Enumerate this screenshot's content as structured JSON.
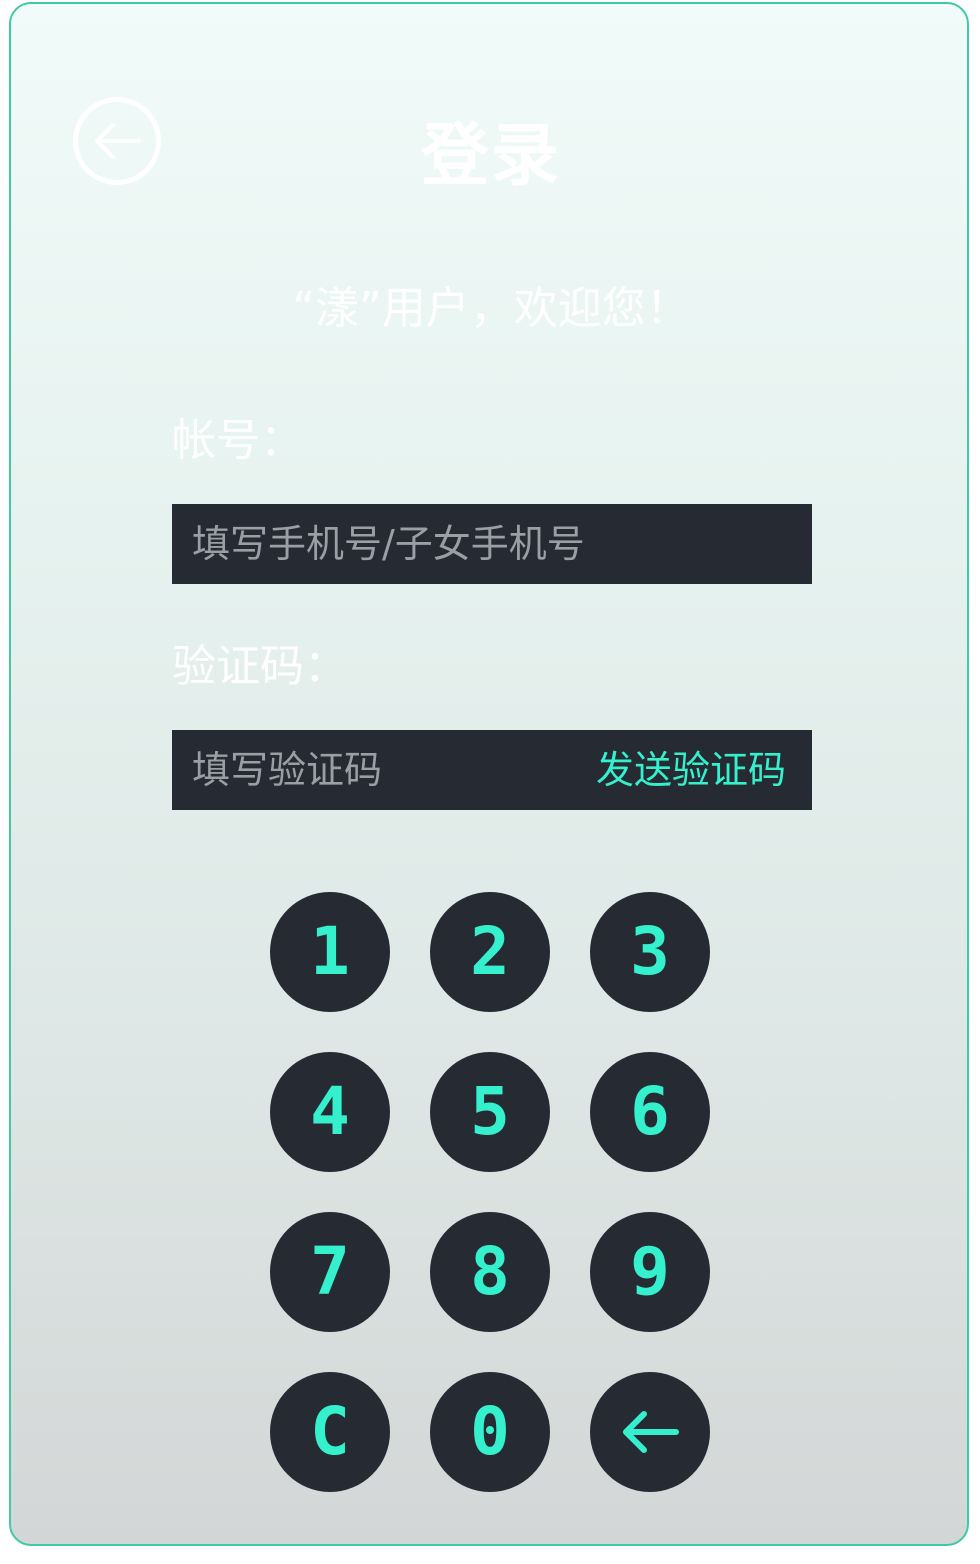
{
  "header": {
    "back_icon": "arrow-left-circle-icon",
    "title": "登录"
  },
  "welcome": "“漾”用户，欢迎您！",
  "form": {
    "account": {
      "label": "帐号：",
      "placeholder": "填写手机号/子女手机号",
      "value": ""
    },
    "code": {
      "label": "验证码：",
      "placeholder": "填写验证码",
      "value": "",
      "send_label": "发送验证码"
    }
  },
  "keypad": {
    "keys": {
      "k1": "1",
      "k2": "2",
      "k3": "3",
      "k4": "4",
      "k5": "5",
      "k6": "6",
      "k7": "7",
      "k8": "8",
      "k9": "9",
      "clear": "C",
      "k0": "0"
    },
    "backspace_icon": "arrow-left-icon"
  },
  "colors": {
    "accent": "#35f0cc",
    "key_background": "#262a33",
    "input_background": "#262a33",
    "border": "#3fc9a6"
  }
}
